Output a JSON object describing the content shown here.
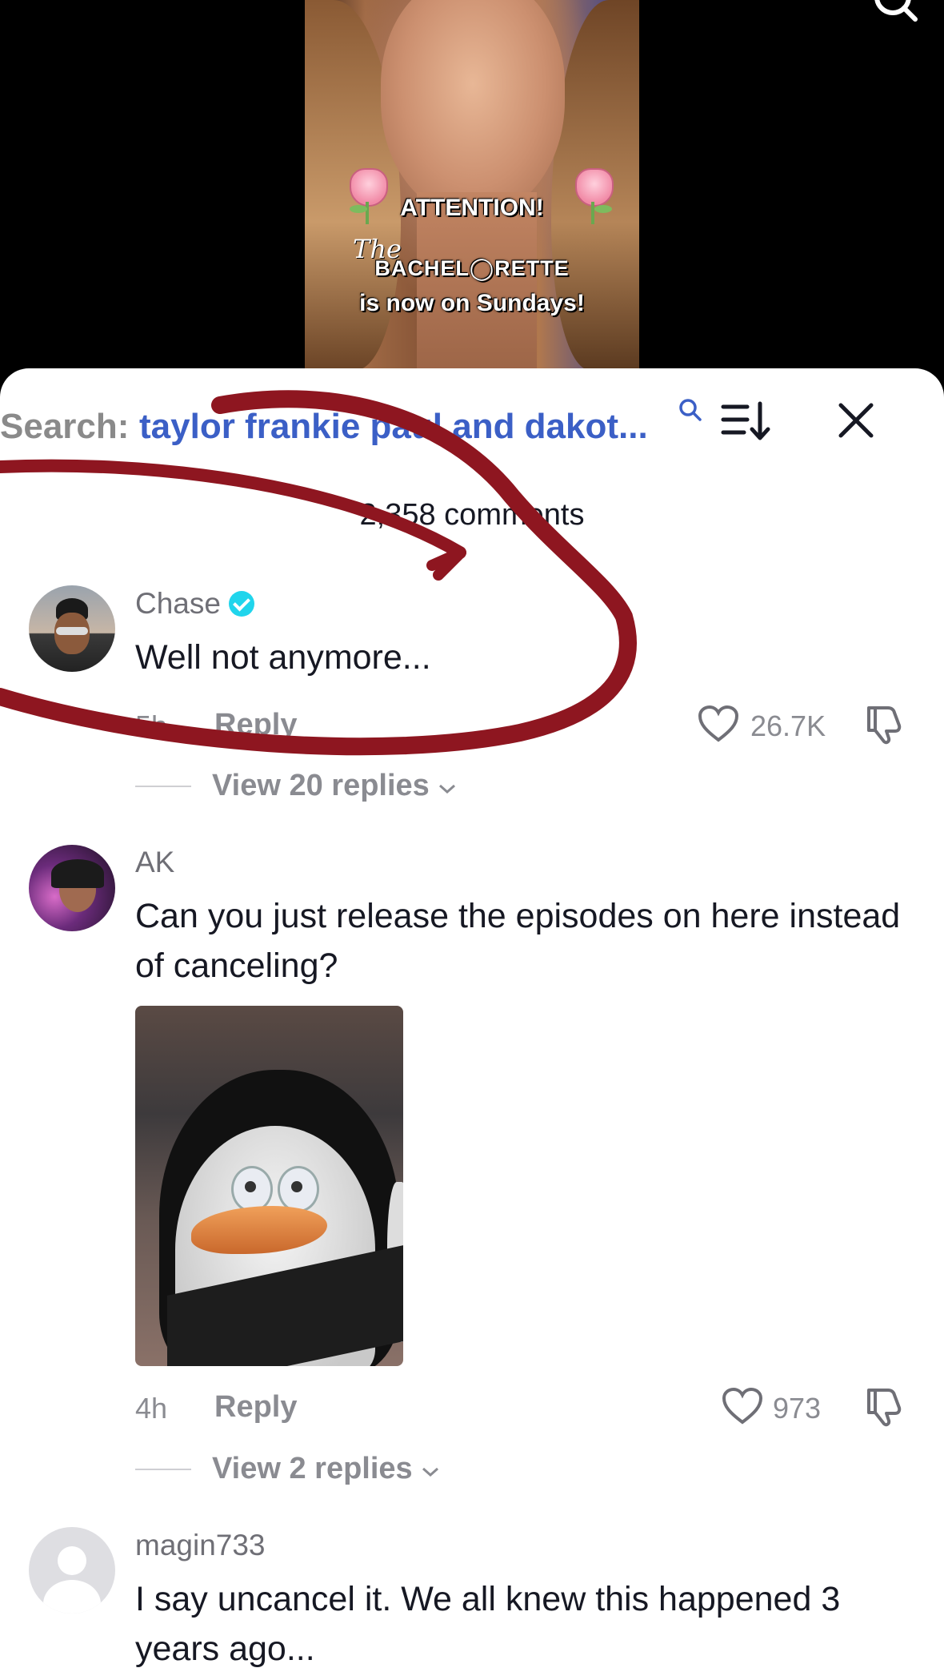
{
  "video": {
    "caption_line1": "ATTENTION!",
    "caption_script": "The",
    "caption_line2": "BACHEL◯RETTE",
    "caption_line3": "is now on Sundays!"
  },
  "search": {
    "label": "Search:",
    "query": "taylor frankie paul and dakot..."
  },
  "comments_header": {
    "count_text": "2,358 comments"
  },
  "comments": [
    {
      "username": "Chase",
      "verified": true,
      "text": "Well not anymore...",
      "time": "5h",
      "reply_label": "Reply",
      "likes": "26.7K",
      "view_replies": "View 20 replies"
    },
    {
      "username": "AK",
      "verified": false,
      "text": "Can you just release the episodes on here instead of canceling?",
      "time": "4h",
      "reply_label": "Reply",
      "likes": "973",
      "view_replies": "View 2 replies"
    },
    {
      "username": "magin733",
      "verified": false,
      "text": "I say uncancel it. We all knew this happened 3 years ago..."
    }
  ],
  "colors": {
    "accent_link": "#3b5fc6",
    "verified": "#20d5ec",
    "annotation": "#8e1620"
  },
  "icons": [
    "search-icon",
    "sort-icon",
    "close-icon",
    "heart-icon",
    "dislike-icon",
    "chevron-down-icon",
    "verified-badge-icon"
  ]
}
